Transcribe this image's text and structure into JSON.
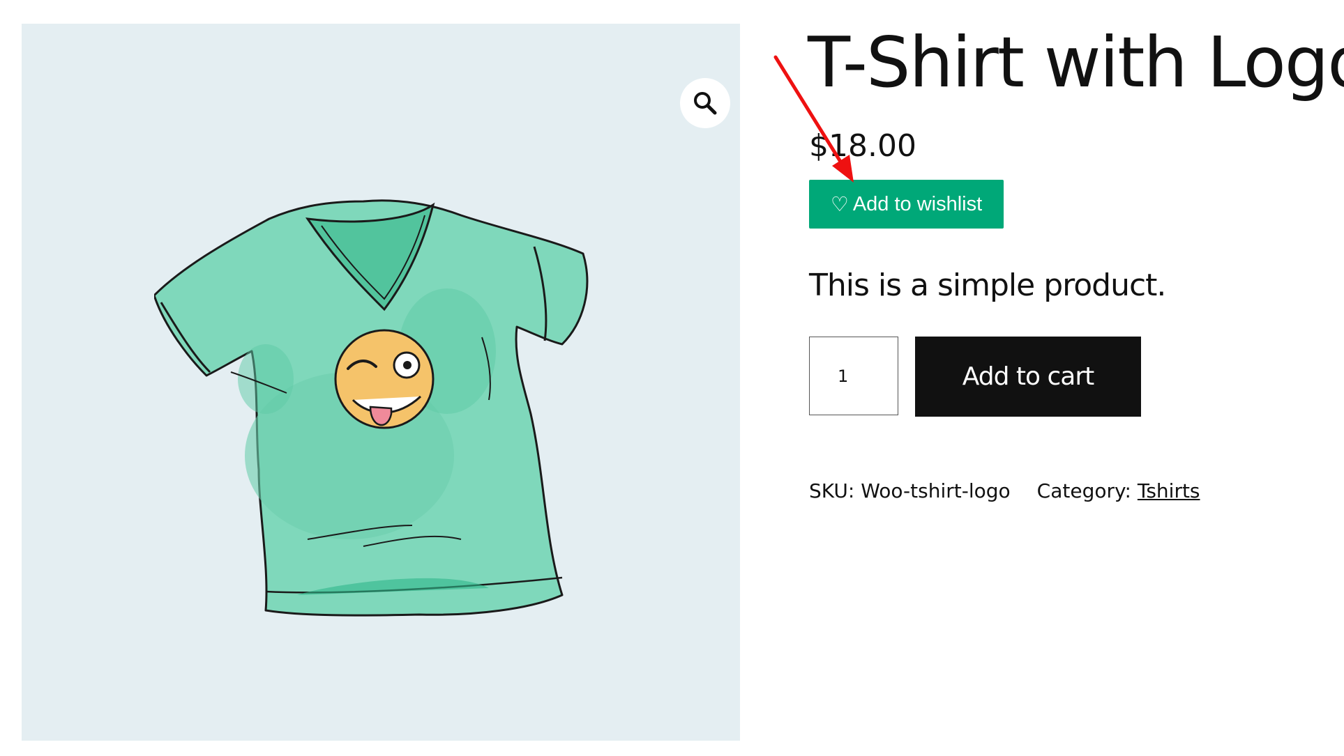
{
  "product": {
    "title": "T-Shirt with Logo",
    "price": "$18.00",
    "description": "This is a simple product.",
    "wishlist_icon": "♡",
    "wishlist_label": "Add to wishlist",
    "quantity": "1",
    "add_to_cart_label": "Add to cart",
    "sku_label": "SKU:",
    "sku_value": "Woo-tshirt-logo",
    "category_label": "Category:",
    "category_value": "Tshirts"
  },
  "gallery": {
    "zoom_icon": "magnifier-icon",
    "image": "green-tshirt-with-winking-emoji"
  },
  "colors": {
    "wishlist_button": "#00a878",
    "add_to_cart_button": "#111111",
    "gallery_background": "#e4eef2",
    "annotation_arrow": "#ee1111"
  }
}
